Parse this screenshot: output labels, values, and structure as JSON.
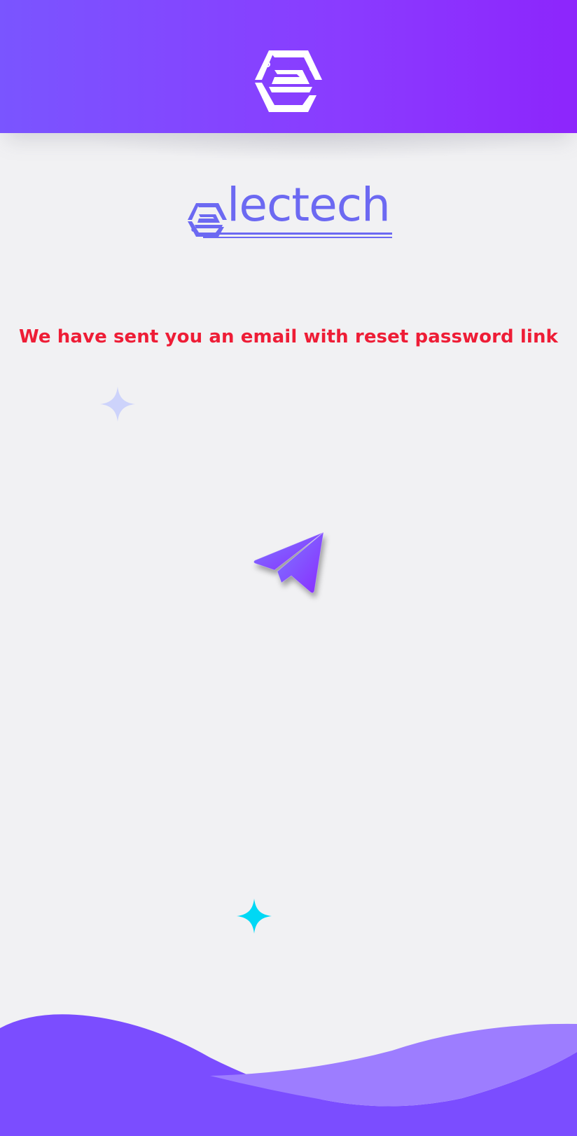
{
  "header": {
    "logo_icon": "electech-hexagon-e-icon"
  },
  "brand": {
    "wordmark": "lectech",
    "mark_icon": "electech-e-mark-icon"
  },
  "message": {
    "text": "We have sent you an email with reset password link"
  },
  "illustration": {
    "plane_icon": "paper-plane-icon",
    "sparkle_icons": [
      "sparkle-icon",
      "sparkle-icon"
    ]
  },
  "colors": {
    "header_gradient_start": "#7a55ff",
    "header_gradient_end": "#8d25fc",
    "brand": "#6c69f2",
    "message": "#ee1d36",
    "background": "#f1f1f3",
    "sparkle_light": "#cdd3fb",
    "sparkle_cyan": "#00d8f5",
    "wave_dark": "#7b4dff",
    "wave_light": "#9d7dff"
  }
}
